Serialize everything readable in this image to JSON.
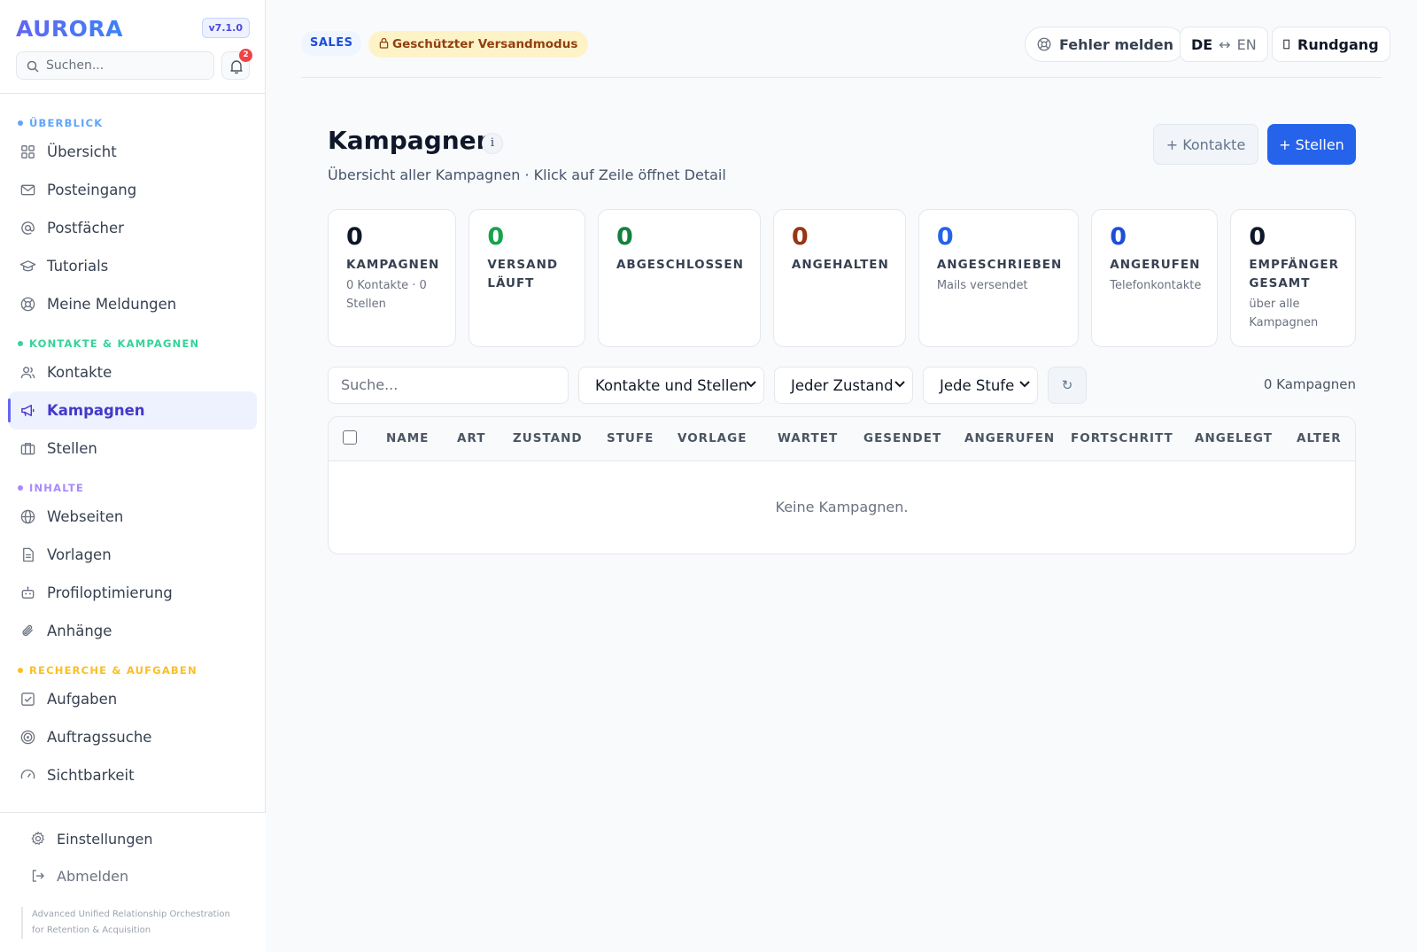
{
  "sidebar": {
    "brand": "AURORA",
    "version": "v7.1.0",
    "search_placeholder": "Suchen...",
    "notification_count": "2",
    "sections": [
      {
        "label": "ÜBERBLICK",
        "color": "#60a5fa"
      },
      {
        "label": "KONTAKTE & KAMPAGNEN",
        "color": "#34d399"
      },
      {
        "label": "INHALTE",
        "color": "#a78bfa"
      },
      {
        "label": "RECHERCHE & AUFGABEN",
        "color": "#fbbf24"
      }
    ],
    "items": [
      {
        "label": "Übersicht",
        "icon": "grid-icon"
      },
      {
        "label": "Posteingang",
        "icon": "mail-icon"
      },
      {
        "label": "Postfächer",
        "icon": "at-sign-icon"
      },
      {
        "label": "Tutorials",
        "icon": "graduation-cap-icon"
      },
      {
        "label": "Meine Meldungen",
        "icon": "lifebuoy-icon"
      },
      {
        "label": "Kontakte",
        "icon": "users-icon"
      },
      {
        "label": "Kampagnen",
        "icon": "megaphone-icon",
        "active": true
      },
      {
        "label": "Stellen",
        "icon": "briefcase-icon"
      },
      {
        "label": "Webseiten",
        "icon": "globe-icon"
      },
      {
        "label": "Vorlagen",
        "icon": "file-text-icon"
      },
      {
        "label": "Profiloptimierung",
        "icon": "robot-icon"
      },
      {
        "label": "Anhänge",
        "icon": "paperclip-icon"
      },
      {
        "label": "Aufgaben",
        "icon": "check-square-icon"
      },
      {
        "label": "Auftragssuche",
        "icon": "target-icon"
      },
      {
        "label": "Sichtbarkeit",
        "icon": "gauge-icon"
      }
    ],
    "bottom": {
      "settings": "Einstellungen",
      "logout": "Abmelden",
      "tagline": "Advanced Unified Relationship Orchestration for Retention & Acquisition"
    }
  },
  "topbar": {
    "sales_pill": "SALES",
    "mode_pill": "Geschützter Versandmodus",
    "report_button": "Fehler melden",
    "lang_de": "DE",
    "lang_arrow": "↔",
    "lang_en": "EN",
    "tour_button": "Rundgang"
  },
  "page": {
    "title": "Kampagnen",
    "info": "i",
    "subtitle": "Übersicht aller Kampagnen · Klick auf Zeile öffnet Detail",
    "btn_kontakte": "+ Kontakte",
    "btn_stellen": "+ Stellen"
  },
  "stats": [
    {
      "value": "0",
      "label": "KAMPAGNEN",
      "sub": "0 Kontakte · 0 Stellen",
      "color": "#0f172a"
    },
    {
      "value": "0",
      "label": "VERSAND LÄUFT",
      "sub": "",
      "color": "#16a34a"
    },
    {
      "value": "0",
      "label": "ABGESCHLOSSEN",
      "sub": "",
      "color": "#15803d"
    },
    {
      "value": "0",
      "label": "ANGEHALTEN",
      "sub": "",
      "color": "#9a3412"
    },
    {
      "value": "0",
      "label": "ANGESCHRIEBEN",
      "sub": "Mails versendet",
      "color": "#2563eb"
    },
    {
      "value": "0",
      "label": "ANGERUFEN",
      "sub": "Telefonkontakte",
      "color": "#1d4ed8"
    },
    {
      "value": "0",
      "label": "EMPFÄNGER GESAMT",
      "sub": "über alle Kampagnen",
      "color": "#0f172a"
    }
  ],
  "filters": {
    "search_placeholder": "Suche...",
    "type_select": "Kontakte und Stellen",
    "state_select": "Jeder Zustand",
    "stage_select": "Jede Stufe",
    "refresh": "↻",
    "count": "0 Kampagnen"
  },
  "table": {
    "columns": [
      "NAME",
      "ART",
      "ZUSTAND",
      "STUFE",
      "VORLAGE",
      "WARTET",
      "GESENDET",
      "ANGERUFEN",
      "FORTSCHRITT",
      "ANGELEGT",
      "ALTER"
    ],
    "empty": "Keine Kampagnen."
  }
}
